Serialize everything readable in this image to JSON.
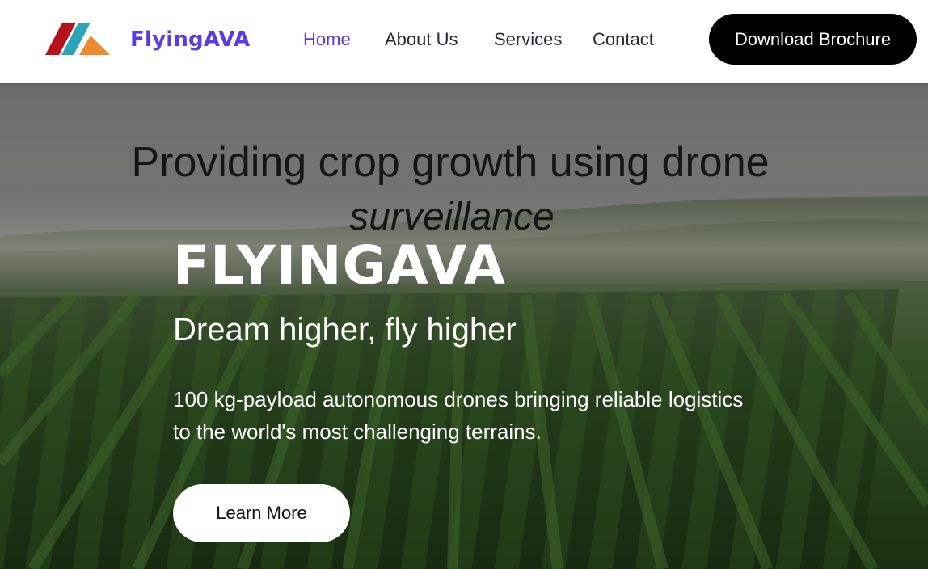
{
  "header": {
    "brand": "FlyingAVA",
    "logo_icon": "flyingava-logo-icon",
    "nav": [
      {
        "label": "Home",
        "active": true
      },
      {
        "label": "About Us",
        "active": false
      },
      {
        "label": "Services",
        "active": false
      },
      {
        "label": "Contact",
        "active": false
      }
    ],
    "cta_label": "Download Brochure"
  },
  "hero": {
    "banner_line1": "Providing crop growth using drone",
    "banner_line2": "surveillance",
    "title": "FLYINGAVA",
    "subtitle": "Dream higher, fly higher",
    "description": "100 kg-payload autonomous drones bringing reliable logistics to the world's most challenging terrains.",
    "button_label": "Learn More",
    "background": "crop-field-image"
  },
  "colors": {
    "accent": "#5a3be8",
    "nav_text": "#222a3f",
    "cta_bg": "#000000",
    "logo_red": "#b5121b",
    "logo_teal": "#2ba6b8",
    "logo_orange": "#ee8a2f"
  }
}
